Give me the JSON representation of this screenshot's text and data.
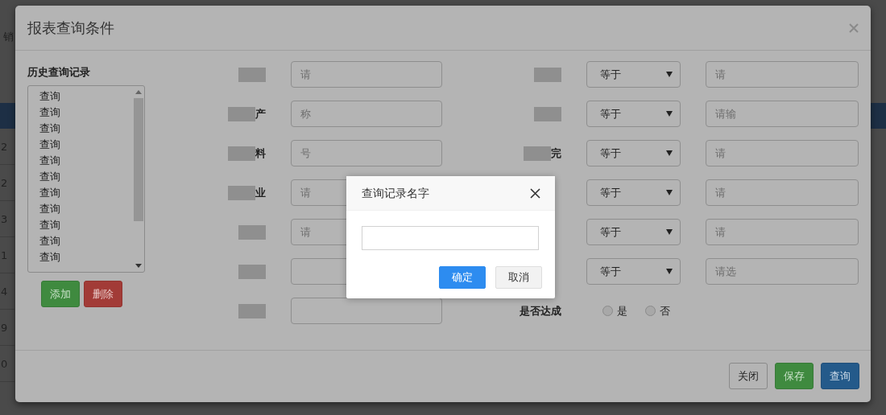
{
  "background": {
    "menu_text": "销",
    "row_numbers": [
      "2",
      "2",
      "3",
      "1",
      "4",
      "9",
      "0"
    ]
  },
  "modal": {
    "title": "报表查询条件",
    "history": {
      "heading": "历史查询记录",
      "items": [
        {
          "label": "查询",
          "selected": false
        },
        {
          "label": "查询",
          "selected": false
        },
        {
          "label": "查询",
          "selected": false
        },
        {
          "label": "查询",
          "selected": false
        },
        {
          "label": "查询",
          "selected": false
        },
        {
          "label": "查询",
          "selected": false
        },
        {
          "label": "查询",
          "selected": false
        },
        {
          "label": "查询",
          "selected": false
        },
        {
          "label": "查询",
          "selected": false
        },
        {
          "label": "查询",
          "selected": false
        },
        {
          "label": "查询",
          "selected": false
        }
      ],
      "buttons": [
        {
          "label": "添加",
          "kind": "success"
        },
        {
          "label": "删除",
          "kind": "danger"
        }
      ]
    },
    "left_fields": [
      {
        "redacted": true,
        "placeholder": "请"
      },
      {
        "label": "产",
        "redacted": true,
        "placeholder": "称"
      },
      {
        "label": "料",
        "redacted": true,
        "placeholder": "号"
      },
      {
        "label": "业",
        "redacted": true,
        "placeholder": "请"
      },
      {
        "redacted": true,
        "placeholder": "请"
      },
      {
        "redacted": true
      },
      {
        "redacted": true
      }
    ],
    "right_fields": [
      {
        "redacted": true,
        "operator": "等于",
        "placeholder": "请"
      },
      {
        "redacted": true,
        "operator": "等于",
        "placeholder": "请输"
      },
      {
        "label": "完",
        "redacted": true,
        "operator": "等于",
        "placeholder": "请"
      },
      {
        "operator": "等于",
        "placeholder": "请"
      },
      {
        "operator": "等于",
        "placeholder": "请"
      },
      {
        "operator": "等于",
        "placeholder": "请选"
      }
    ],
    "achieved": {
      "label": "是否达成",
      "options": [
        {
          "label": "是",
          "selected": false
        },
        {
          "label": "否",
          "selected": false
        }
      ]
    },
    "footer_buttons": [
      {
        "label": "关闭",
        "kind": "default"
      },
      {
        "label": "保存",
        "kind": "success"
      },
      {
        "label": "查询",
        "kind": "primary"
      }
    ]
  },
  "name_dialog": {
    "title": "查询记录名字",
    "buttons": [
      {
        "label": "确定",
        "kind": "primary"
      },
      {
        "label": "取消",
        "kind": "default"
      }
    ]
  }
}
